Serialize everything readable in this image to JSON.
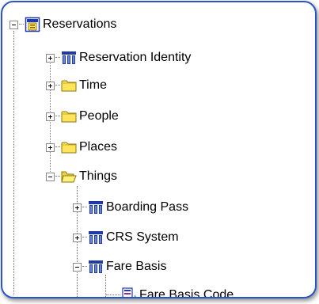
{
  "tree": {
    "root": {
      "label": "Reservations",
      "icon": "root-table-icon",
      "state": "expanded"
    },
    "items": [
      {
        "label": "Reservation Identity",
        "icon": "entity-icon",
        "state": "collapsed"
      },
      {
        "label": "Time",
        "icon": "folder-icon",
        "state": "collapsed"
      },
      {
        "label": "People",
        "icon": "folder-icon",
        "state": "collapsed"
      },
      {
        "label": "Places",
        "icon": "folder-icon",
        "state": "collapsed"
      },
      {
        "label": "Things",
        "icon": "folder-open-icon",
        "state": "expanded"
      }
    ],
    "things_children": [
      {
        "label": "Boarding Pass",
        "icon": "entity-icon",
        "state": "collapsed"
      },
      {
        "label": "CRS System",
        "icon": "entity-icon",
        "state": "collapsed"
      },
      {
        "label": "Fare Basis",
        "icon": "entity-icon",
        "state": "expanded"
      }
    ],
    "fare_basis_children": [
      {
        "label": "Fare Basis Code",
        "icon": "attribute-icon"
      }
    ]
  },
  "colors": {
    "frame_border": "#2a55c8",
    "entity_blue": "#1f3aa8",
    "folder_yellow": "#ffe45c"
  }
}
